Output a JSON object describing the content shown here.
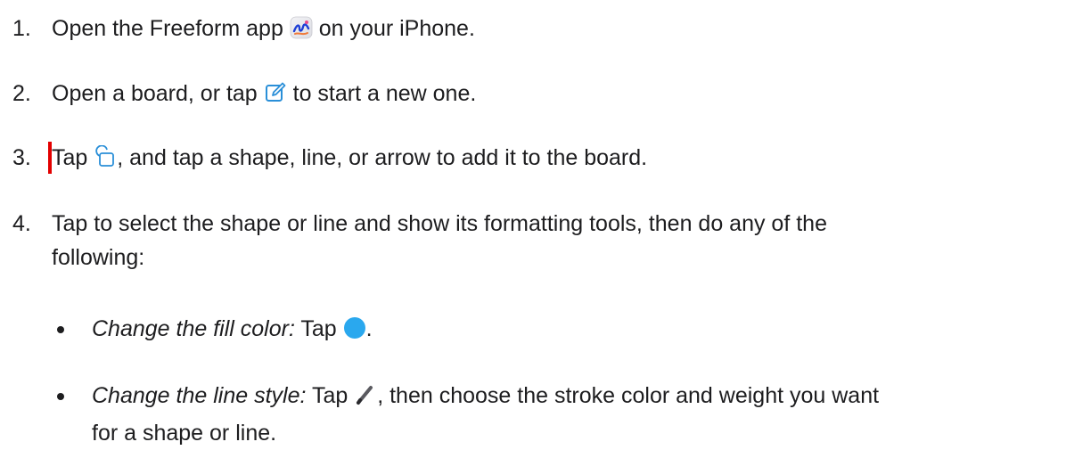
{
  "steps": [
    {
      "num": "1.",
      "before": "Open the Freeform app",
      "after": "on your iPhone.",
      "icon": "freeform-app-icon"
    },
    {
      "num": "2.",
      "before": "Open a board, or tap",
      "after": "to start a new one.",
      "icon": "compose-icon"
    },
    {
      "num": "3.",
      "before": "Tap",
      "after": ", and tap a shape, line, or arrow to add it to the board.",
      "icon": "shapes-icon"
    },
    {
      "num": "4.",
      "text_line1": "Tap to select the shape or line and show its formatting tools, then do any of the",
      "text_line2": "following:"
    }
  ],
  "sub_items": [
    {
      "label": "Change the fill color:",
      "before": "Tap",
      "after": ".",
      "icon": "fill-color-icon"
    },
    {
      "label": "Change the line style:",
      "before": "Tap",
      "after": ", then choose the stroke color and weight you want",
      "line2": "for a shape or line.",
      "icon": "pencil-stroke-icon"
    }
  ],
  "colors": {
    "text": "#1d1d1f",
    "accent": "#0071e3",
    "fill_blue": "#2aa8ee",
    "marker": "#e30000"
  }
}
